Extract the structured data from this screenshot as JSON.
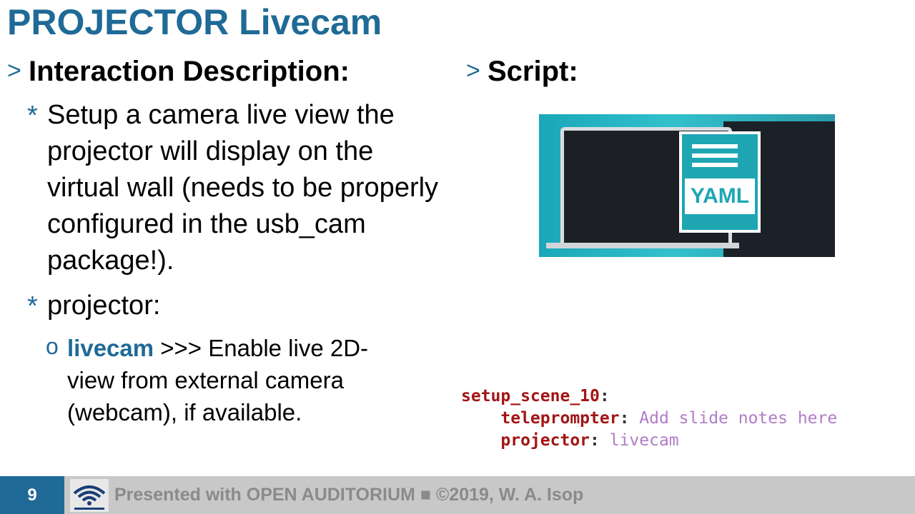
{
  "slide": {
    "title": "PROJECTOR Livecam",
    "number": "9"
  },
  "left": {
    "heading_bullet": ">",
    "heading": "Interaction Description:",
    "items": [
      {
        "bullet": "*",
        "text": "Setup a camera live view the projector will display on the virtual wall (needs to be properly configured in the usb_cam package!)."
      },
      {
        "bullet": "*",
        "text": "projector:"
      }
    ],
    "sub_item": {
      "bullet": "o",
      "keyword": "livecam",
      "text": " >>> Enable live 2D-view from external camera (webcam), if available."
    }
  },
  "right": {
    "heading_bullet": ">",
    "heading": "Script:",
    "image_label": "YAML",
    "code": {
      "line1_key": "setup_scene_10",
      "line1_punct": ":",
      "line2_key": "teleprompter",
      "line2_punct": ": ",
      "line2_value": "Add slide notes here",
      "line3_key": "projector",
      "line3_punct": ": ",
      "line3_value": "livecam"
    }
  },
  "footer": {
    "credit": "Presented with OPEN AUDITORIUM ■ ©2019, W. A. Isop"
  },
  "colors": {
    "accent": "#1f6a96",
    "footer_bg": "#c8c8c8",
    "code_key": "#a31515",
    "code_value": "#b07cc6"
  }
}
